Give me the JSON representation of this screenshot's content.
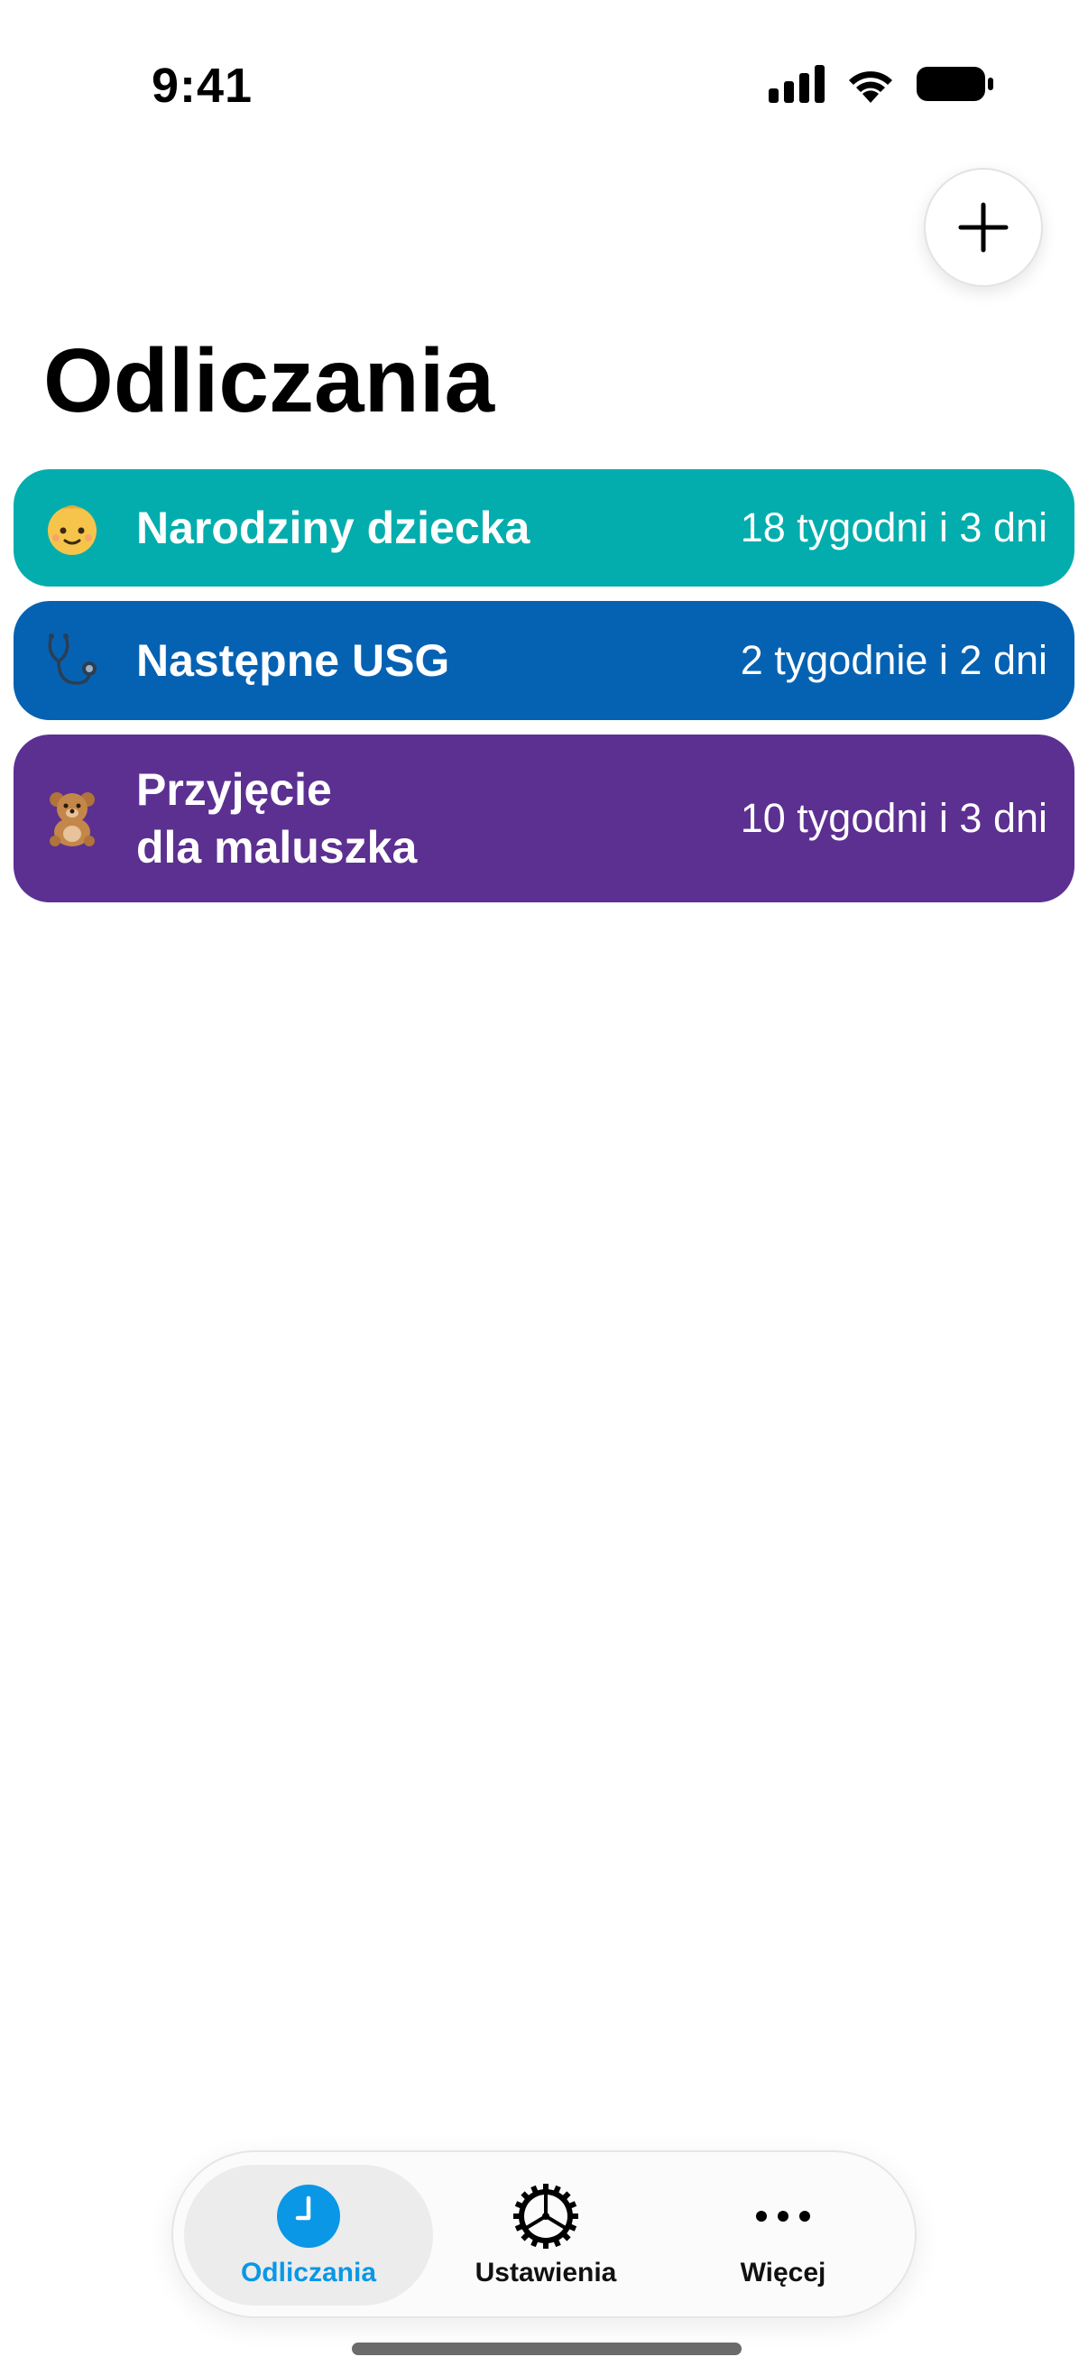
{
  "status_bar": {
    "time": "9:41",
    "icons": [
      "signal-icon",
      "wifi-icon",
      "battery-icon"
    ]
  },
  "header": {
    "add_button_icon": "plus-icon",
    "title": "Odliczania"
  },
  "countdowns": [
    {
      "emoji": "baby-icon",
      "title_lines": [
        "Narodziny dziecka"
      ],
      "remaining": "18 tygodni i 3 dni",
      "color": "#03ADAD"
    },
    {
      "emoji": "stethoscope-icon",
      "title_lines": [
        "Następne USG"
      ],
      "remaining": "2 tygodnie i 2 dni",
      "color": "#0562B3"
    },
    {
      "emoji": "teddy-bear-icon",
      "title_lines": [
        "Przyjęcie",
        "dla maluszka"
      ],
      "remaining": "10 tygodni i 3 dni",
      "color": "#5C3091"
    }
  ],
  "tab_bar": {
    "tabs": [
      {
        "label": "Odliczania",
        "icon": "clock-icon",
        "active": true
      },
      {
        "label": "Ustawienia",
        "icon": "gear-icon",
        "active": false
      },
      {
        "label": "Więcej",
        "icon": "more-icon",
        "active": false
      }
    ],
    "accent": "#0A97E6"
  }
}
